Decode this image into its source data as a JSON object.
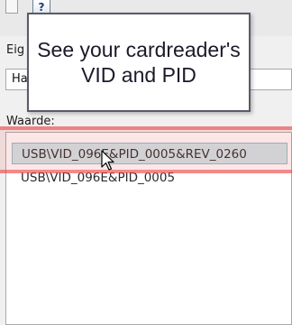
{
  "header": {
    "help_icon": "?"
  },
  "property": {
    "label": "Eig",
    "dropdown_value": "Ha"
  },
  "value_section": {
    "label": "Waarde:"
  },
  "values": [
    {
      "text": "USB\\VID_096E&PID_0005&REV_0260",
      "selected": true
    },
    {
      "text": "USB\\VID_096E&PID_0005",
      "selected": false
    }
  ],
  "callout": {
    "text": "See your cardreader's VID and PID"
  },
  "colors": {
    "selection": "#cde8ea",
    "highlight": "#eb3c3c"
  }
}
